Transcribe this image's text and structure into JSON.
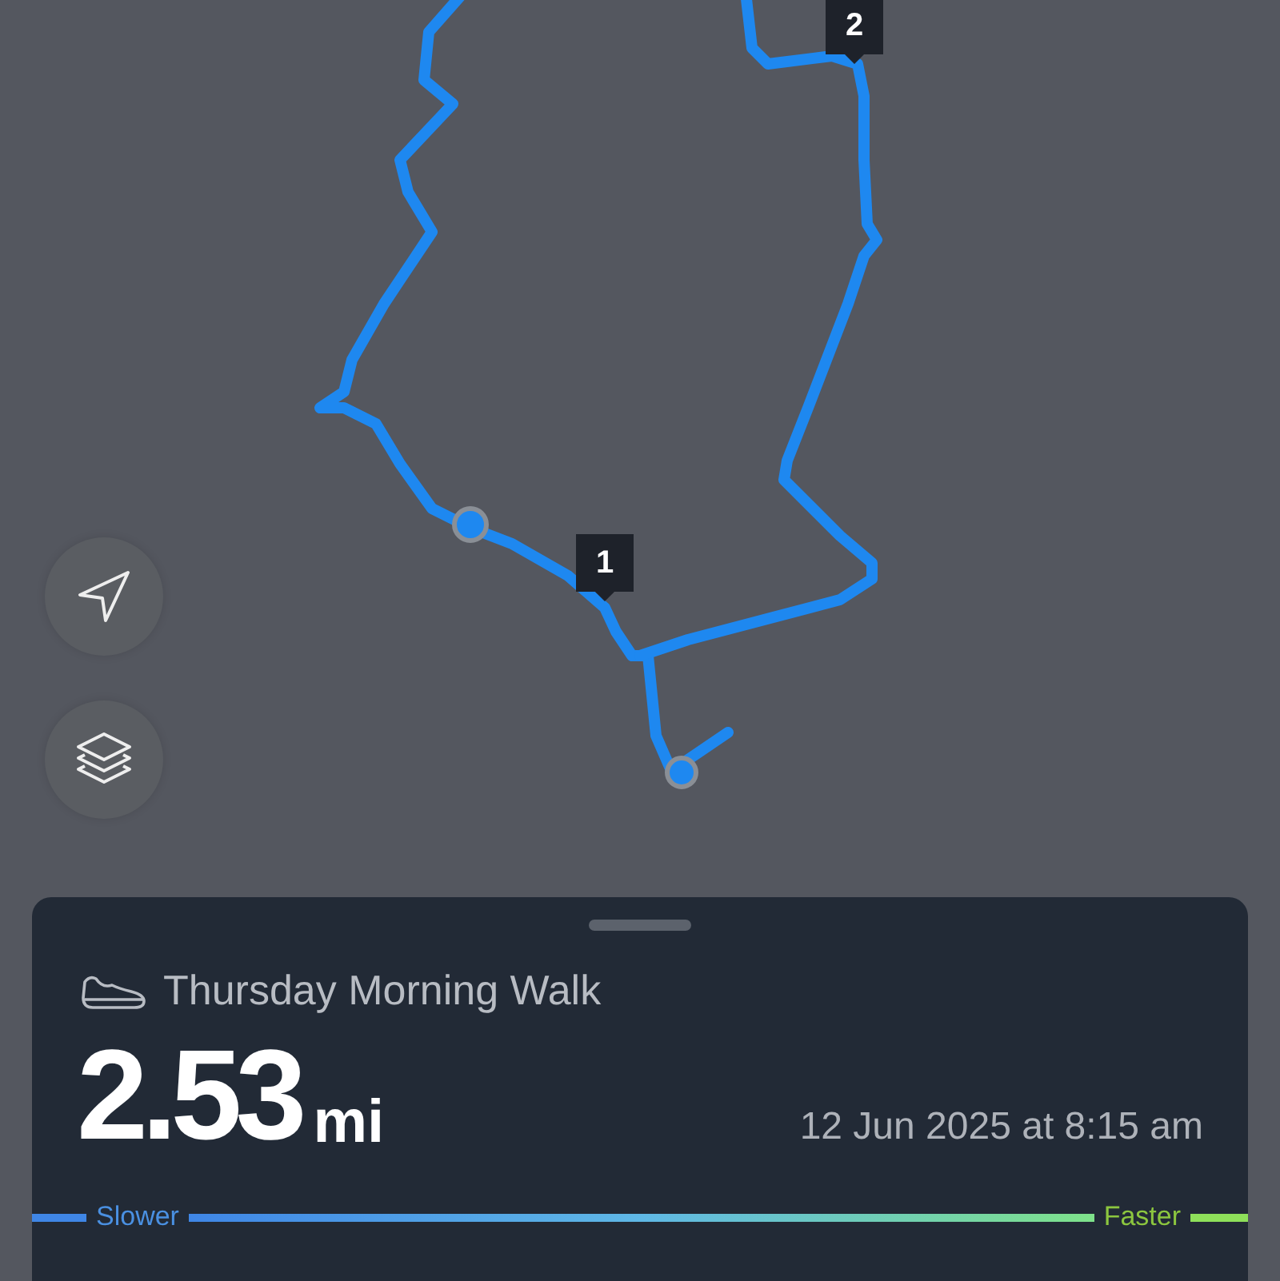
{
  "map": {
    "markers": [
      {
        "label": "1"
      },
      {
        "label": "2"
      }
    ]
  },
  "map_controls": [
    {
      "kind": "locate"
    },
    {
      "kind": "layers"
    }
  ],
  "activity": {
    "title": "Thursday Morning Walk",
    "distance": "2.53",
    "unit": "mi",
    "date": "12 Jun 2025 at 8:15 am"
  },
  "pace_legend": {
    "slower": "Slower",
    "faster": "Faster"
  }
}
